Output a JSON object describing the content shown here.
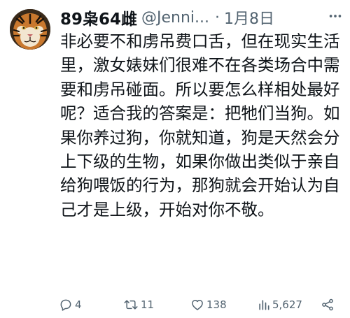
{
  "tweet": {
    "display_name": "89枭64雌",
    "handle": "@Jenni...",
    "separator": "·",
    "date": "1月8日",
    "text": "非必要不和虏吊费口舌，但在现实生活里，激女婊妹们很难不在各类场合中需要和虏吊碰面。所以要怎么样相处最好呢？适合我的答案是：把牠们当狗。如果你养过狗，你就知道，狗是天然会分上下级的生物，如果你做出类似于亲自给狗喂饭的行为，那狗就会开始认为自己才是上级，开始对你不敬。",
    "replies": "4",
    "retweets": "11",
    "likes": "138",
    "views": "5,627"
  },
  "icons": {
    "avatar": "tiger-avatar",
    "more": "more-dots-icon",
    "reply": "reply-icon",
    "retweet": "retweet-icon",
    "like": "heart-icon",
    "views": "views-icon",
    "share": "share-icon"
  },
  "colors": {
    "text": "#0f1419",
    "secondary": "#536471",
    "background": "#ffffff"
  }
}
